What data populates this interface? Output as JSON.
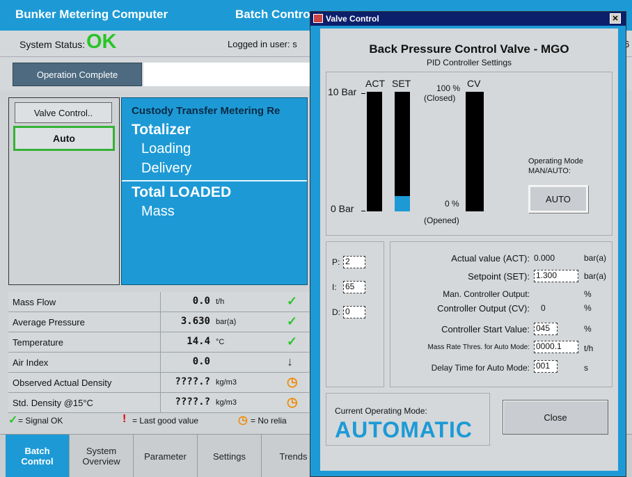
{
  "app": {
    "title": "Bunker Metering Computer",
    "page_title": "Batch Contro",
    "status_label": "System Status:",
    "status_value": "OK",
    "logged_in_label": "Logged in user: s",
    "status_right_fragment": "6",
    "operation_complete_label": "Operation Complete",
    "valve_control_button": "Valve Control..",
    "auto_button": "Auto",
    "custody": {
      "title": "Custody Transfer Metering Re",
      "totalizer": "Totalizer",
      "loading": "Loading",
      "delivery": "Delivery",
      "total_loaded": "Total LOADED",
      "mass": "Mass"
    },
    "measurements": [
      {
        "name": "Mass Flow",
        "value": "0.0",
        "unit": "t/h",
        "status_icon": "checkmark-icon",
        "glyph": "✓"
      },
      {
        "name": "Average Pressure",
        "value": "3.630",
        "unit": "bar(a)",
        "status_icon": "checkmark-icon",
        "glyph": "✓"
      },
      {
        "name": "Temperature",
        "value": "14.4",
        "unit": "°C",
        "status_icon": "checkmark-icon",
        "glyph": "✓"
      },
      {
        "name": "Air Index",
        "value": "0.0",
        "unit": "",
        "status_icon": "down-arrow-icon",
        "glyph": "↓"
      },
      {
        "name": "Observed Actual Density",
        "value": "????.?",
        "unit": "kg/m3",
        "status_icon": "clock-icon",
        "glyph": "◷"
      },
      {
        "name": "Std. Density @15°C",
        "value": "????.?",
        "unit": "kg/m3",
        "status_icon": "clock-icon",
        "glyph": "◷"
      }
    ],
    "legend": {
      "signal_ok": "= Signal OK",
      "last_good": "= Last good value",
      "no_reliable": "= No relia",
      "ok_glyph": "✓",
      "last_glyph": "!",
      "clock_glyph": "◷"
    },
    "nav_tabs": [
      {
        "label": "Batch\nControl",
        "active": true
      },
      {
        "label": "System\nOverview",
        "active": false
      },
      {
        "label": "Parameter",
        "active": false
      },
      {
        "label": "Settings",
        "active": false
      },
      {
        "label": "Trends",
        "active": false
      }
    ],
    "colors": {
      "accent": "#1d9ad6",
      "ok_green": "#28c528",
      "warn_orange": "#f08a00",
      "error_red": "#e00000"
    }
  },
  "dialog": {
    "title": "Valve Control",
    "close_glyph": "✕",
    "heading": "Back Pressure Control Valve - MGO",
    "subheading": "PID Controller Settings",
    "bars": {
      "top_scale_label": "10 Bar",
      "bottom_scale_label": "0 Bar",
      "act_label": "ACT",
      "set_label": "SET",
      "act_fraction": 0.0,
      "set_fraction": 0.13,
      "cv_label": "CV",
      "cv_top_label": "100 %",
      "cv_top_sub": "(Closed)",
      "cv_bottom_label": "0 %",
      "cv_bottom_sub": "(Opened)",
      "cv_fraction": 0.0
    },
    "operating_mode_caption_1": "Operating Mode",
    "operating_mode_caption_2": "MAN/AUTO:",
    "mode_button": "AUTO",
    "pid": {
      "p_label": "P:",
      "p_value": "2",
      "i_label": "I:",
      "i_value": "65",
      "d_label": "D:",
      "d_value": "0"
    },
    "values": {
      "actual_label": "Actual value (ACT):",
      "actual_value": "0.000",
      "actual_unit": "bar(a)",
      "setpoint_label": "Setpoint (SET):",
      "setpoint_value": "1.300",
      "setpoint_unit": "bar(a)",
      "man_output_label": "Man. Controller Output:",
      "man_output_unit": "%",
      "cv_output_label": "Controller Output (CV):",
      "cv_output_value": "0",
      "cv_output_unit": "%",
      "start_label": "Controller Start Value:",
      "start_value": "045",
      "start_unit": "%",
      "mass_rate_label": "Mass Rate Thres. for Auto Mode:",
      "mass_rate_value": "0000.1",
      "mass_rate_unit": "t/h",
      "delay_label": "Delay Time for Auto Mode:",
      "delay_value": "001",
      "delay_unit": "s"
    },
    "current_mode_label": "Current Operating Mode:",
    "current_mode_value": "AUTOMATIC",
    "close_button": "Close"
  }
}
